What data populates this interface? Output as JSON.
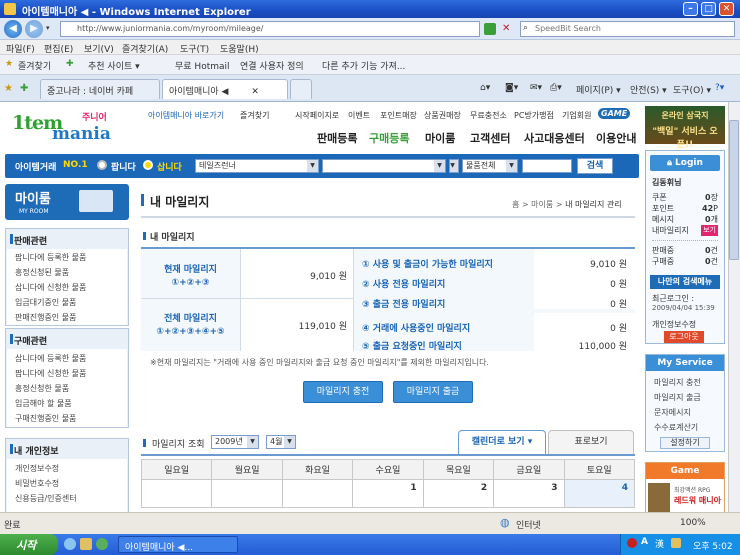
{
  "window": {
    "title": "아이템매니아 ◀ - Windows Internet Explorer"
  },
  "address": {
    "url": "http://www.juniormania.com/myroom/mileage/",
    "search_placeholder": "SpeedBit Search"
  },
  "menu": [
    "파일(F)",
    "편집(E)",
    "보기(V)",
    "즐겨찾기(A)",
    "도구(T)",
    "도움말(H)"
  ],
  "favorites": {
    "label": "즐겨찾기",
    "items": [
      "추천 사이트 ▾",
      "무료 Hotmail",
      "연결 사용자 정의",
      "다른 추가 기능 가져..."
    ]
  },
  "tabs": [
    {
      "label": "중고나라 : 네이버 카페"
    },
    {
      "label": "아이템매니아 ◀"
    }
  ],
  "commands": {
    "page": "페이지(P) ▾",
    "safety": "안전(S) ▾",
    "tools": "도구(O) ▾"
  },
  "site": {
    "logo": {
      "part1": "1tem",
      "part2": "mania",
      "part3": "주니어"
    },
    "toplinks": [
      "아이템매니아 바로가기",
      "즐겨찾기",
      "시작페이지로",
      "이벤트",
      "포인트매장",
      "상품권매장",
      "무료충전소",
      "PC방가맹점",
      "기업회원",
      "GAME"
    ],
    "mainnav": [
      "판매등록",
      "구매등록",
      "마이룸",
      "고객센터",
      "사고대응센터",
      "이용안내"
    ],
    "searchbar": {
      "label": "아이템거래",
      "rank": "NO.1",
      "sell": "팝니다",
      "buy": "삽니다",
      "game": "테일즈런너",
      "server": "",
      "type": "",
      "category": "물품전체",
      "keyword": "",
      "search_button": "검색"
    },
    "myroom": {
      "title": "마이룸",
      "subtitle": "MY ROOM"
    },
    "sidebar": [
      {
        "title": "판매관련",
        "items": [
          "팝니다에 등록한 물품",
          "흥정신청된 물품",
          "삽니다에 신청한 물품",
          "입금대기중인 물품",
          "판매진행중인 물품"
        ]
      },
      {
        "title": "구매관련",
        "items": [
          "삽니다에 등록한 물품",
          "팝니다에 신청한 물품",
          "흥정신청한 물품",
          "입금해야 할 물품",
          "구매진행중인 물품"
        ]
      },
      {
        "title": "내 개인정보",
        "items": [
          "개인정보수정",
          "비밀번호수정",
          "신용등급/인증센터"
        ]
      }
    ],
    "content": {
      "title": "내 마일리지",
      "breadcrumb": [
        "홈",
        "마이룸",
        "내 마일리지 관리"
      ],
      "section": "내 마일리지",
      "current": {
        "label": "현재 마일리지",
        "formula": "①+②+③",
        "total": "9,010 원"
      },
      "total_row": {
        "label": "전체 마일리지",
        "formula": "①+②+③+④+⑤",
        "total": "119,010 원"
      },
      "rows": [
        {
          "label": "① 사용 및 출금이 가능한 마일리지",
          "value": "9,010 원"
        },
        {
          "label": "② 사용 전용 마일리지",
          "value": "0 원"
        },
        {
          "label": "③ 출금 전용 마일리지",
          "value": "0 원"
        },
        {
          "label": "④ 거래에 사용중인 마일리지",
          "value": "0 원"
        },
        {
          "label": "⑤ 출금 요청중인 마일리지",
          "value": "110,000 원"
        }
      ],
      "note": "※현재 마일리지는 \"거래에 사용 중인 마일리지와 출금 요청 중인 마일리지\"를 제외한 마일리지입니다.",
      "btn_charge": "마일리지 충전",
      "btn_withdraw": "마일리지 출금",
      "query_label": "마일리지 조회",
      "year": "2009년",
      "month": "4월",
      "tab_calendar": "캘린더로 보기",
      "tab_table": "표로보기",
      "weekdays": [
        "일요일",
        "월요일",
        "화요일",
        "수요일",
        "목요일",
        "금요일",
        "토요일"
      ],
      "days": [
        "",
        "",
        "",
        "1",
        "2",
        "3",
        "4"
      ]
    },
    "right": {
      "banner1": "온라인 삼국지",
      "banner2": "\"백일\" 서비스 오픈!!",
      "login": "Login",
      "user": "김동휘님",
      "stats": [
        {
          "label": "쿠폰",
          "value": "0",
          "unit": "장"
        },
        {
          "label": "포인트",
          "value": "42",
          "unit": "P"
        },
        {
          "label": "메시지",
          "value": "0",
          "unit": "개"
        },
        {
          "label": "내마일리지",
          "value": "보기",
          "unit": ""
        }
      ],
      "stats2": [
        {
          "label": "판매중",
          "value": "0",
          "unit": "건"
        },
        {
          "label": "구매중",
          "value": "0",
          "unit": "건"
        }
      ],
      "search_menu": "나만의 검색메뉴",
      "last_login_label": "최근로그인 :",
      "last_login": "2009/04/04 15:39",
      "personal_edit": "개인정보수정",
      "logout": "로그아웃",
      "myservice": "My Service",
      "services": [
        "마일리지 충전",
        "마일리지 출금",
        "문자메시지",
        "수수료계산기"
      ],
      "settings": "설정하기",
      "game": "Game",
      "game_desc1": "최강액션 RPG",
      "game_desc2": "레드워 매니아"
    }
  },
  "status": {
    "done": "완료",
    "zone": "인터넷",
    "zoom": "100%"
  },
  "taskbar": {
    "start": "시작",
    "task": "아이템매니아 ◀...",
    "time": "오후 5:02"
  }
}
